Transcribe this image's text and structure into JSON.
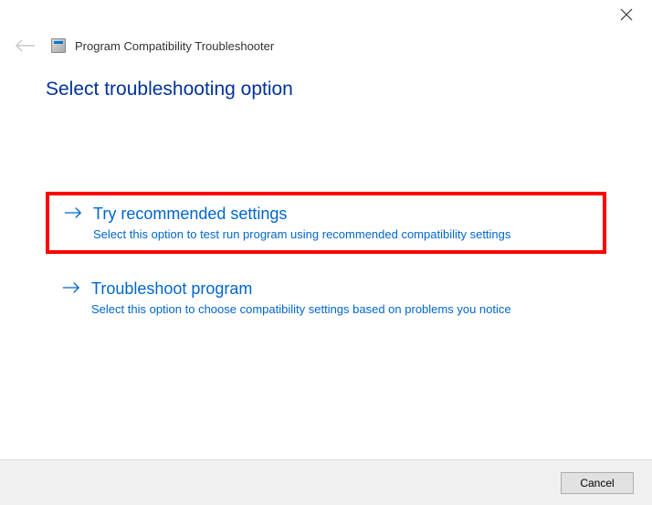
{
  "window": {
    "title": "Program Compatibility Troubleshooter"
  },
  "heading": "Select troubleshooting option",
  "options": [
    {
      "title": "Try recommended settings",
      "description": "Select this option to test run program using recommended compatibility settings"
    },
    {
      "title": "Troubleshoot program",
      "description": "Select this option to choose compatibility settings based on problems you notice"
    }
  ],
  "footer": {
    "cancel": "Cancel"
  }
}
